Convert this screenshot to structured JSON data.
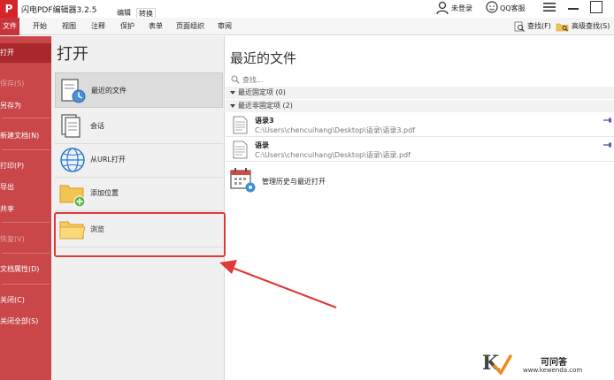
{
  "app": {
    "logo_text": "P",
    "title": "闪电PDF编辑器3.2.5",
    "modes": [
      "编辑",
      "转换"
    ]
  },
  "titlebar": {
    "login": "未登录",
    "support": "QQ客服"
  },
  "ribbon": {
    "tabs": [
      "文件",
      "开始",
      "视图",
      "注释",
      "保护",
      "表单",
      "页面组织",
      "审阅"
    ],
    "find": "查找(F)",
    "advanced_find": "高级查找(S)"
  },
  "sidebar": {
    "items": [
      {
        "label": "打开",
        "state": "active"
      },
      {
        "label": "保存(S)",
        "state": "disabled"
      },
      {
        "label": "另存为",
        "state": "normal"
      },
      {
        "label": "新建文档(N)",
        "state": "normal"
      },
      {
        "label": "打印(P)",
        "state": "normal"
      },
      {
        "label": "导出",
        "state": "normal"
      },
      {
        "label": "共享",
        "state": "normal"
      },
      {
        "label": "恢复(V)",
        "state": "disabled"
      },
      {
        "label": "文档属性(D)",
        "state": "normal"
      },
      {
        "label": "关闭(C)",
        "state": "normal"
      },
      {
        "label": "关闭全部(S)",
        "state": "normal"
      }
    ]
  },
  "open_pane": {
    "title": "打开",
    "items": [
      {
        "label": "最近的文件",
        "icon": "recent-files-icon"
      },
      {
        "label": "会话",
        "icon": "session-icon"
      },
      {
        "label": "从URL打开",
        "icon": "globe-icon"
      },
      {
        "label": "添加位置",
        "icon": "add-folder-icon"
      },
      {
        "label": "浏览",
        "icon": "folder-icon"
      }
    ]
  },
  "recent": {
    "title": "最近的文件",
    "search_placeholder": "查找...",
    "pinned_header": "最近固定项 (0)",
    "unpinned_header": "最近非固定项 (2)",
    "files": [
      {
        "name": "语录3",
        "path": "C:\\Users\\chencuihang\\Desktop\\语录\\语录3.pdf"
      },
      {
        "name": "语录",
        "path": "C:\\Users\\chencuihang\\Desktop\\语录\\语录.pdf"
      }
    ],
    "manage": "管理历史与最近打开"
  },
  "watermark": {
    "logo": "K",
    "name": "可问答",
    "url": "www.kewenda.com"
  },
  "colors": {
    "brand_red": "#c94749",
    "active_red": "#a8282c",
    "highlight": "#e03a36"
  }
}
